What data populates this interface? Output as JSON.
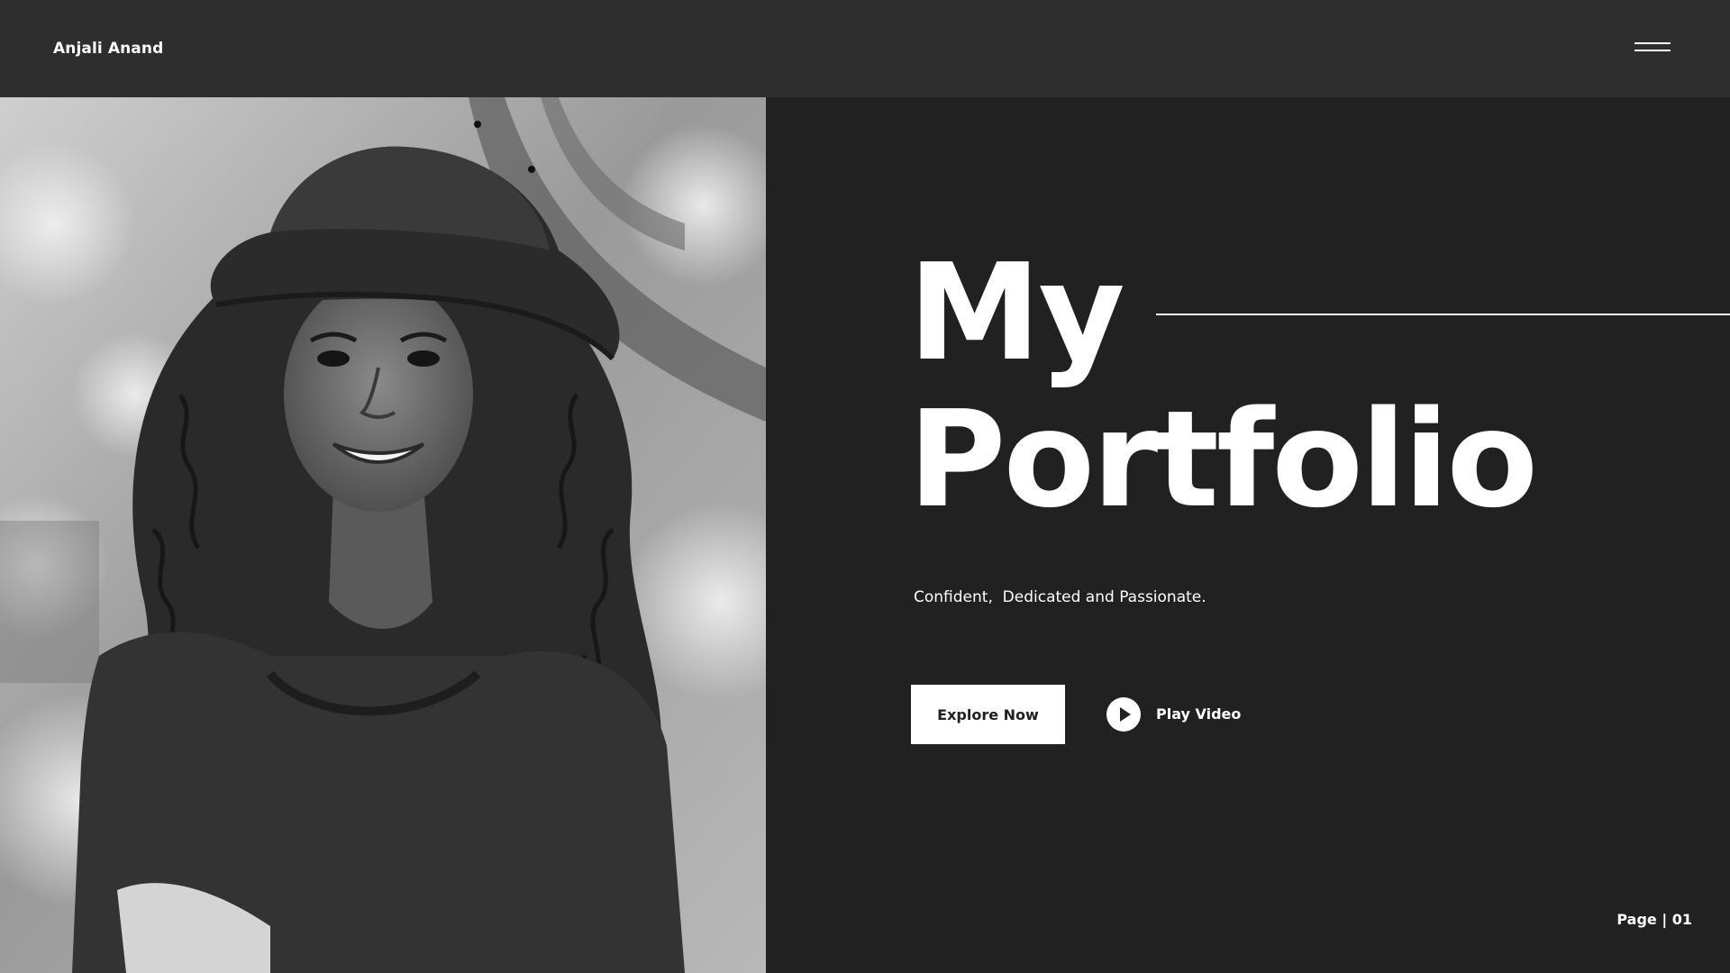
{
  "header": {
    "brand_name": "Anjali Anand",
    "menu_icon": "hamburger-menu-icon"
  },
  "photo": {
    "description_icon": "portrait-photo",
    "style": "black-and-white"
  },
  "hero": {
    "title_line1": "My",
    "title_line2": "Portfolio",
    "tagline": "Confident,  Dedicated and Passionate."
  },
  "actions": {
    "explore_label": "Explore Now",
    "play_label": "Play Video",
    "play_icon": "play-circle-icon"
  },
  "footer": {
    "page_indicator": "Page | 01"
  },
  "colors": {
    "background": "#202120",
    "header_background": "#2e2e2e",
    "text": "#ffffff",
    "button_background": "#ffffff",
    "button_text": "#202020"
  }
}
